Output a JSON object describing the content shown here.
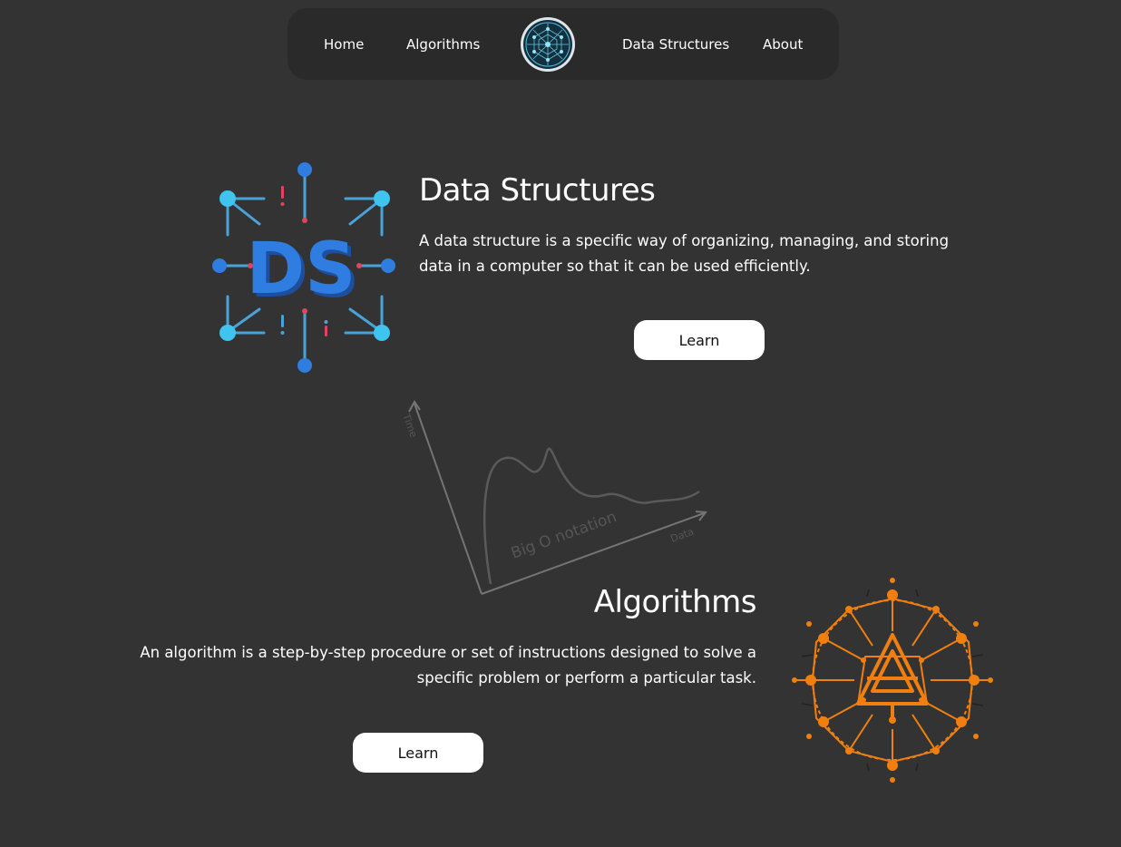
{
  "nav": {
    "items": [
      {
        "label": "Home"
      },
      {
        "label": "Algorithms"
      },
      {
        "label": "Data Structures"
      },
      {
        "label": "About"
      }
    ],
    "logo_icon": "network-globe-icon"
  },
  "data_structures": {
    "title": "Data Structures",
    "description": "A data structure is a specific way of organizing, managing, and storing data in a computer so that it can be used efficiently.",
    "button_label": "Learn",
    "logo_text": "DS",
    "logo_icon": "ds-network-icon",
    "accent_color": "#2f7de1"
  },
  "big_o_illustration": {
    "caption": "Big O notation",
    "x_axis": "Data",
    "y_axis": "Time"
  },
  "algorithms": {
    "title": "Algorithms",
    "description": "An algorithm is a step-by-step procedure or set of instructions designed to solve a specific problem or perform a particular task.",
    "button_label": "Learn",
    "logo_icon": "algorithm-network-icon",
    "accent_color": "#f07f10"
  },
  "colors": {
    "background": "#333333",
    "nav_background": "#2a2a2a",
    "button_background": "#ffffff"
  }
}
